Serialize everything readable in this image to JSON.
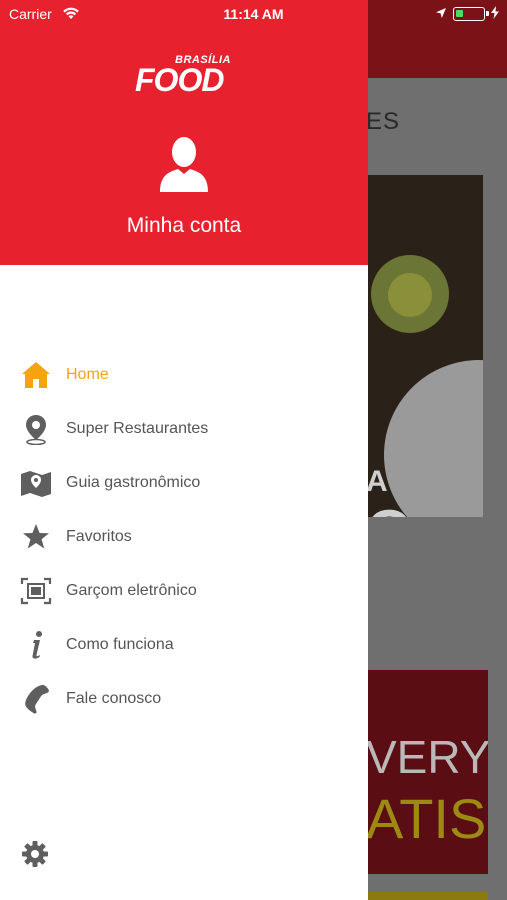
{
  "status_bar": {
    "carrier": "Carrier",
    "time": "11:14 AM",
    "battery_level": 0.25
  },
  "background": {
    "section_label": "ES",
    "photo_text_1": "A",
    "photo_text_2": "O",
    "promo_line_1": "VERY",
    "promo_line_2": "ATIS"
  },
  "drawer": {
    "logo": {
      "small": "BRASÍLIA",
      "main": "FOOD"
    },
    "account_label": "Minha conta",
    "menu": [
      {
        "label": "Home",
        "icon": "home-icon",
        "active": true
      },
      {
        "label": "Super Restaurantes",
        "icon": "location-pin-icon",
        "active": false
      },
      {
        "label": "Guia gastronômico",
        "icon": "map-icon",
        "active": false
      },
      {
        "label": "Favoritos",
        "icon": "star-icon",
        "active": false
      },
      {
        "label": "Garçom eletrônico",
        "icon": "scan-icon",
        "active": false
      },
      {
        "label": "Como funciona",
        "icon": "info-icon",
        "active": false
      },
      {
        "label": "Fale conosco",
        "icon": "phone-icon",
        "active": false
      }
    ]
  },
  "colors": {
    "brand_red": "#e8212f",
    "active_orange": "#f5a30e",
    "menu_text": "#555555",
    "icon_gray": "#5f5f5f"
  }
}
